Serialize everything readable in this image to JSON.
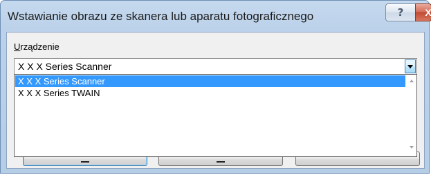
{
  "window": {
    "title": "Wstawianie obrazu ze skanera lub aparatu fotograficznego",
    "help_label": "?",
    "close_label": "X"
  },
  "device": {
    "label_accel": "U",
    "label_rest": "rządzenie",
    "selected_value": "X X X  Series Scanner",
    "options": [
      {
        "label": "X X X  Series Scanner",
        "selected": true
      },
      {
        "label": "X X X  Series TWAIN",
        "selected": false
      }
    ]
  },
  "colors": {
    "selection": "#3399ff",
    "titlebar": "#bcd2ea",
    "dialog_bg": "#f0f0f0"
  },
  "icons": {
    "help": "question-mark",
    "close": "x-mark",
    "dropdown": "chevron-down"
  }
}
